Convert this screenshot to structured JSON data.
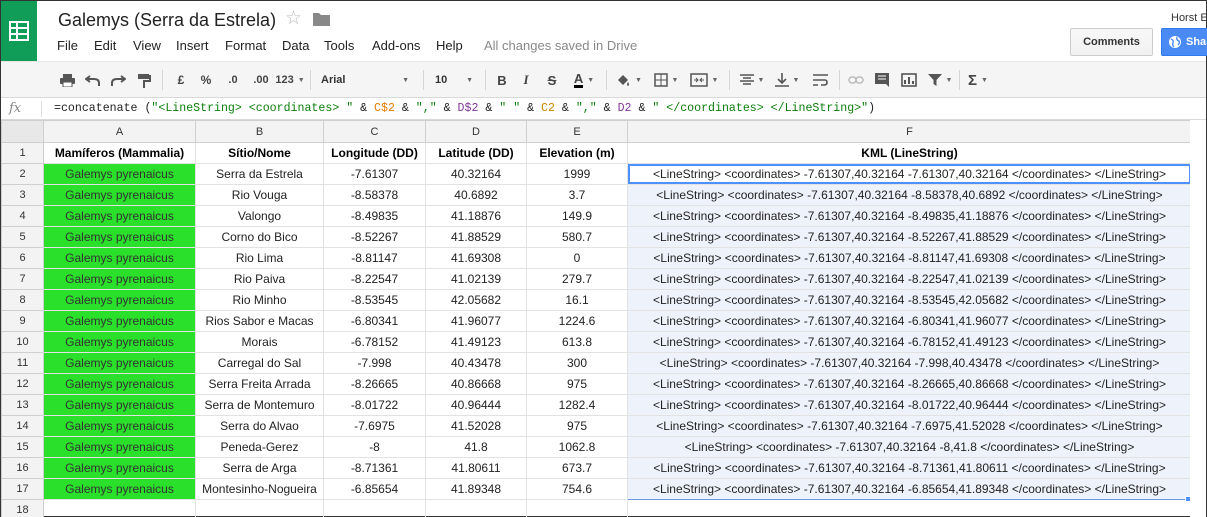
{
  "app": {
    "doc_title": "Galemys (Serra da Estrela)",
    "save_status": "All changes saved in Drive",
    "user_name": "Horst E",
    "comments_label": "Comments",
    "share_label": "Sha"
  },
  "menu": [
    "File",
    "Edit",
    "View",
    "Insert",
    "Format",
    "Data",
    "Tools",
    "Add-ons",
    "Help"
  ],
  "toolbar": {
    "currency": "£",
    "percent": "%",
    "dec_decrease": ".0",
    "dec_increase": ".00",
    "more_formats": "123",
    "font": "Arial",
    "font_size": "10",
    "bold": "B",
    "italic": "I",
    "strike": "S",
    "text_color": "A",
    "functions": "Σ"
  },
  "formula": {
    "fx_label": "fx",
    "parts": [
      {
        "t": "=concatenate (",
        "c": ""
      },
      {
        "t": "\"<LineString> <coordinates> \"",
        "c": "str"
      },
      {
        "t": " & ",
        "c": ""
      },
      {
        "t": "C$2",
        "c": "ref1"
      },
      {
        "t": " & ",
        "c": ""
      },
      {
        "t": "\",\"",
        "c": "str"
      },
      {
        "t": " & ",
        "c": ""
      },
      {
        "t": "D$2",
        "c": "ref2"
      },
      {
        "t": " & ",
        "c": ""
      },
      {
        "t": "\" \"",
        "c": "str"
      },
      {
        "t": " & ",
        "c": ""
      },
      {
        "t": "C2",
        "c": "ref3"
      },
      {
        "t": " & ",
        "c": ""
      },
      {
        "t": "\",\"",
        "c": "str"
      },
      {
        "t": " & ",
        "c": ""
      },
      {
        "t": "D2",
        "c": "ref2"
      },
      {
        "t": " & ",
        "c": ""
      },
      {
        "t": "\" </coordinates> </LineString>\"",
        "c": "str"
      },
      {
        "t": ")",
        "c": ""
      }
    ]
  },
  "grid": {
    "columns": [
      "A",
      "B",
      "C",
      "D",
      "E",
      "F"
    ],
    "header_row": [
      "Mamíferos (Mammalia)",
      "Sítio/Nome",
      "Longitude (DD)",
      "Latitude (DD)",
      "Elevation (m)",
      "KML (LineString)"
    ],
    "rows": [
      [
        "Galemys pyrenaicus",
        "Serra da Estrela",
        "-7.61307",
        "40.32164",
        "1999",
        "<LineString> <coordinates> -7.61307,40.32164 -7.61307,40.32164 </coordinates> </LineString>"
      ],
      [
        "Galemys pyrenaicus",
        "Rio Vouga",
        "-8.58378",
        "40.6892",
        "3.7",
        "<LineString> <coordinates> -7.61307,40.32164 -8.58378,40.6892 </coordinates> </LineString>"
      ],
      [
        "Galemys pyrenaicus",
        "Valongo",
        "-8.49835",
        "41.18876",
        "149.9",
        "<LineString> <coordinates> -7.61307,40.32164 -8.49835,41.18876 </coordinates> </LineString>"
      ],
      [
        "Galemys pyrenaicus",
        "Corno do Bico",
        "-8.52267",
        "41.88529",
        "580.7",
        "<LineString> <coordinates> -7.61307,40.32164 -8.52267,41.88529 </coordinates> </LineString>"
      ],
      [
        "Galemys pyrenaicus",
        "Rio Lima",
        "-8.81147",
        "41.69308",
        "0",
        "<LineString> <coordinates> -7.61307,40.32164 -8.81147,41.69308 </coordinates> </LineString>"
      ],
      [
        "Galemys pyrenaicus",
        "Rio Paiva",
        "-8.22547",
        "41.02139",
        "279.7",
        "<LineString> <coordinates> -7.61307,40.32164 -8.22547,41.02139 </coordinates> </LineString>"
      ],
      [
        "Galemys pyrenaicus",
        "Rio Minho",
        "-8.53545",
        "42.05682",
        "16.1",
        "<LineString> <coordinates> -7.61307,40.32164 -8.53545,42.05682 </coordinates> </LineString>"
      ],
      [
        "Galemys pyrenaicus",
        "Rios Sabor e Macas",
        "-6.80341",
        "41.96077",
        "1224.6",
        "<LineString> <coordinates> -7.61307,40.32164 -6.80341,41.96077 </coordinates> </LineString>"
      ],
      [
        "Galemys pyrenaicus",
        "Morais",
        "-6.78152",
        "41.49123",
        "613.8",
        "<LineString> <coordinates> -7.61307,40.32164 -6.78152,41.49123 </coordinates> </LineString>"
      ],
      [
        "Galemys pyrenaicus",
        "Carregal do Sal",
        "-7.998",
        "40.43478",
        "300",
        "<LineString> <coordinates> -7.61307,40.32164 -7.998,40.43478 </coordinates> </LineString>"
      ],
      [
        "Galemys pyrenaicus",
        "Serra Freita Arrada",
        "-8.26665",
        "40.86668",
        "975",
        "<LineString> <coordinates> -7.61307,40.32164 -8.26665,40.86668 </coordinates> </LineString>"
      ],
      [
        "Galemys pyrenaicus",
        "Serra de Montemuro",
        "-8.01722",
        "40.96444",
        "1282.4",
        "<LineString> <coordinates> -7.61307,40.32164 -8.01722,40.96444 </coordinates> </LineString>"
      ],
      [
        "Galemys pyrenaicus",
        "Serra do Alvao",
        "-7.6975",
        "41.52028",
        "975",
        "<LineString> <coordinates> -7.61307,40.32164 -7.6975,41.52028 </coordinates> </LineString>"
      ],
      [
        "Galemys pyrenaicus",
        "Peneda-Gerez",
        "-8",
        "41.8",
        "1062.8",
        "<LineString> <coordinates> -7.61307,40.32164 -8,41.8 </coordinates> </LineString>"
      ],
      [
        "Galemys pyrenaicus",
        "Serra de Arga",
        "-8.71361",
        "41.80611",
        "673.7",
        "<LineString> <coordinates> -7.61307,40.32164 -8.71361,41.80611 </coordinates> </LineString>"
      ],
      [
        "Galemys pyrenaicus",
        "Montesinho-Nogueira",
        "-6.85654",
        "41.89348",
        "754.6",
        "<LineString> <coordinates> -7.61307,40.32164 -6.85654,41.89348 </coordinates> </LineString>"
      ]
    ],
    "row_numbers": [
      "1",
      "2",
      "3",
      "4",
      "5",
      "6",
      "7",
      "8",
      "9",
      "10",
      "11",
      "12",
      "13",
      "14",
      "15",
      "16",
      "17",
      "18"
    ]
  },
  "colors": {
    "species_fill": "#2ae02a",
    "selection": "#4d90fe",
    "app_green": "#0f9d58"
  }
}
